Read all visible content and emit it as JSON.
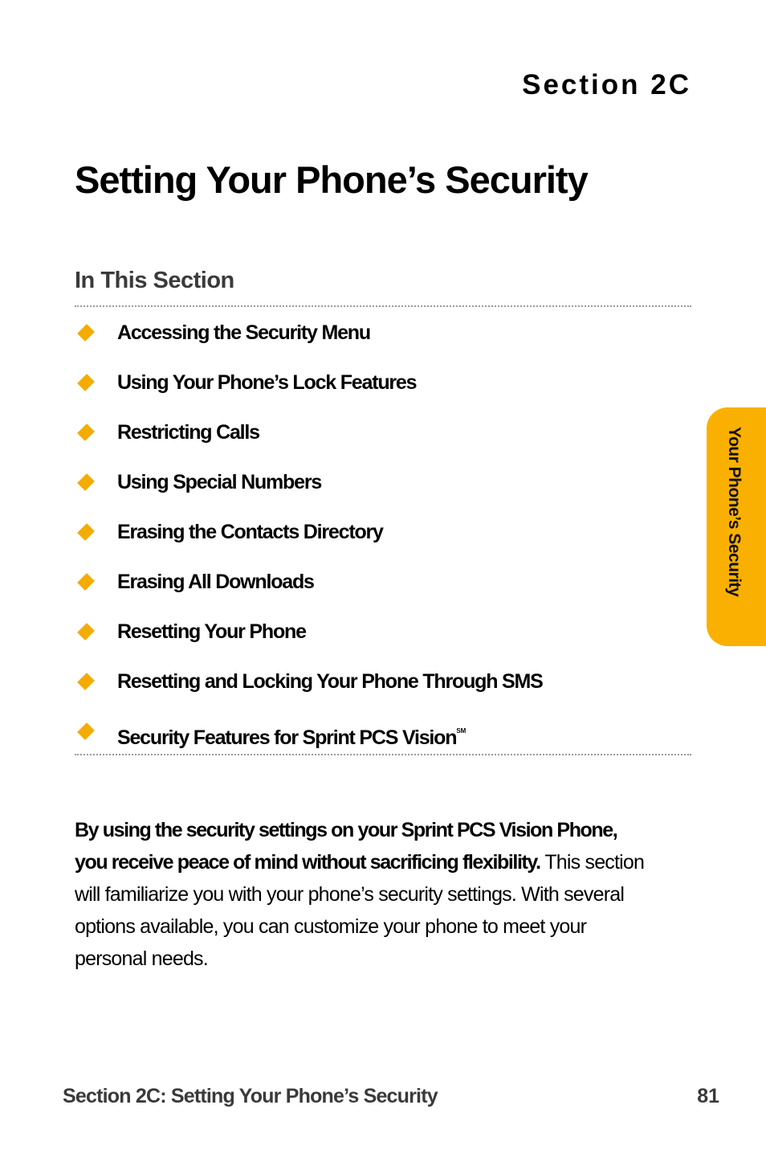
{
  "header": {
    "section_label": "Section 2C",
    "page_title": "Setting Your Phone’s Security"
  },
  "toc": {
    "heading": "In This Section",
    "bullet_icon": "diamond-bullet",
    "items": [
      {
        "label": "Accessing the Security Menu",
        "superscript": ""
      },
      {
        "label": "Using Your Phone’s Lock Features",
        "superscript": ""
      },
      {
        "label": "Restricting Calls",
        "superscript": ""
      },
      {
        "label": "Using Special Numbers",
        "superscript": ""
      },
      {
        "label": "Erasing the Contacts Directory",
        "superscript": ""
      },
      {
        "label": "Erasing All Downloads",
        "superscript": ""
      },
      {
        "label": "Resetting Your Phone",
        "superscript": ""
      },
      {
        "label": "Resetting and Locking Your Phone Through SMS",
        "superscript": ""
      },
      {
        "label": "Security Features for Sprint PCS Vision",
        "superscript": "SM"
      }
    ]
  },
  "intro": {
    "bold_text": "By using the security settings on your Sprint PCS Vision Phone, you receive peace of mind without sacrificing flexibility.",
    "body_text": " This section will familiarize you with your phone’s security settings. With several options available, you can customize your phone to meet your personal needs."
  },
  "side_tab": {
    "label": "Your Phone’s Security"
  },
  "footer": {
    "title": "Section 2C: Setting Your Phone’s Security",
    "page_number": "81"
  },
  "colors": {
    "accent": "#f9b000",
    "bullet": "#f5ac00",
    "heading_gray": "#3a3a3a"
  }
}
